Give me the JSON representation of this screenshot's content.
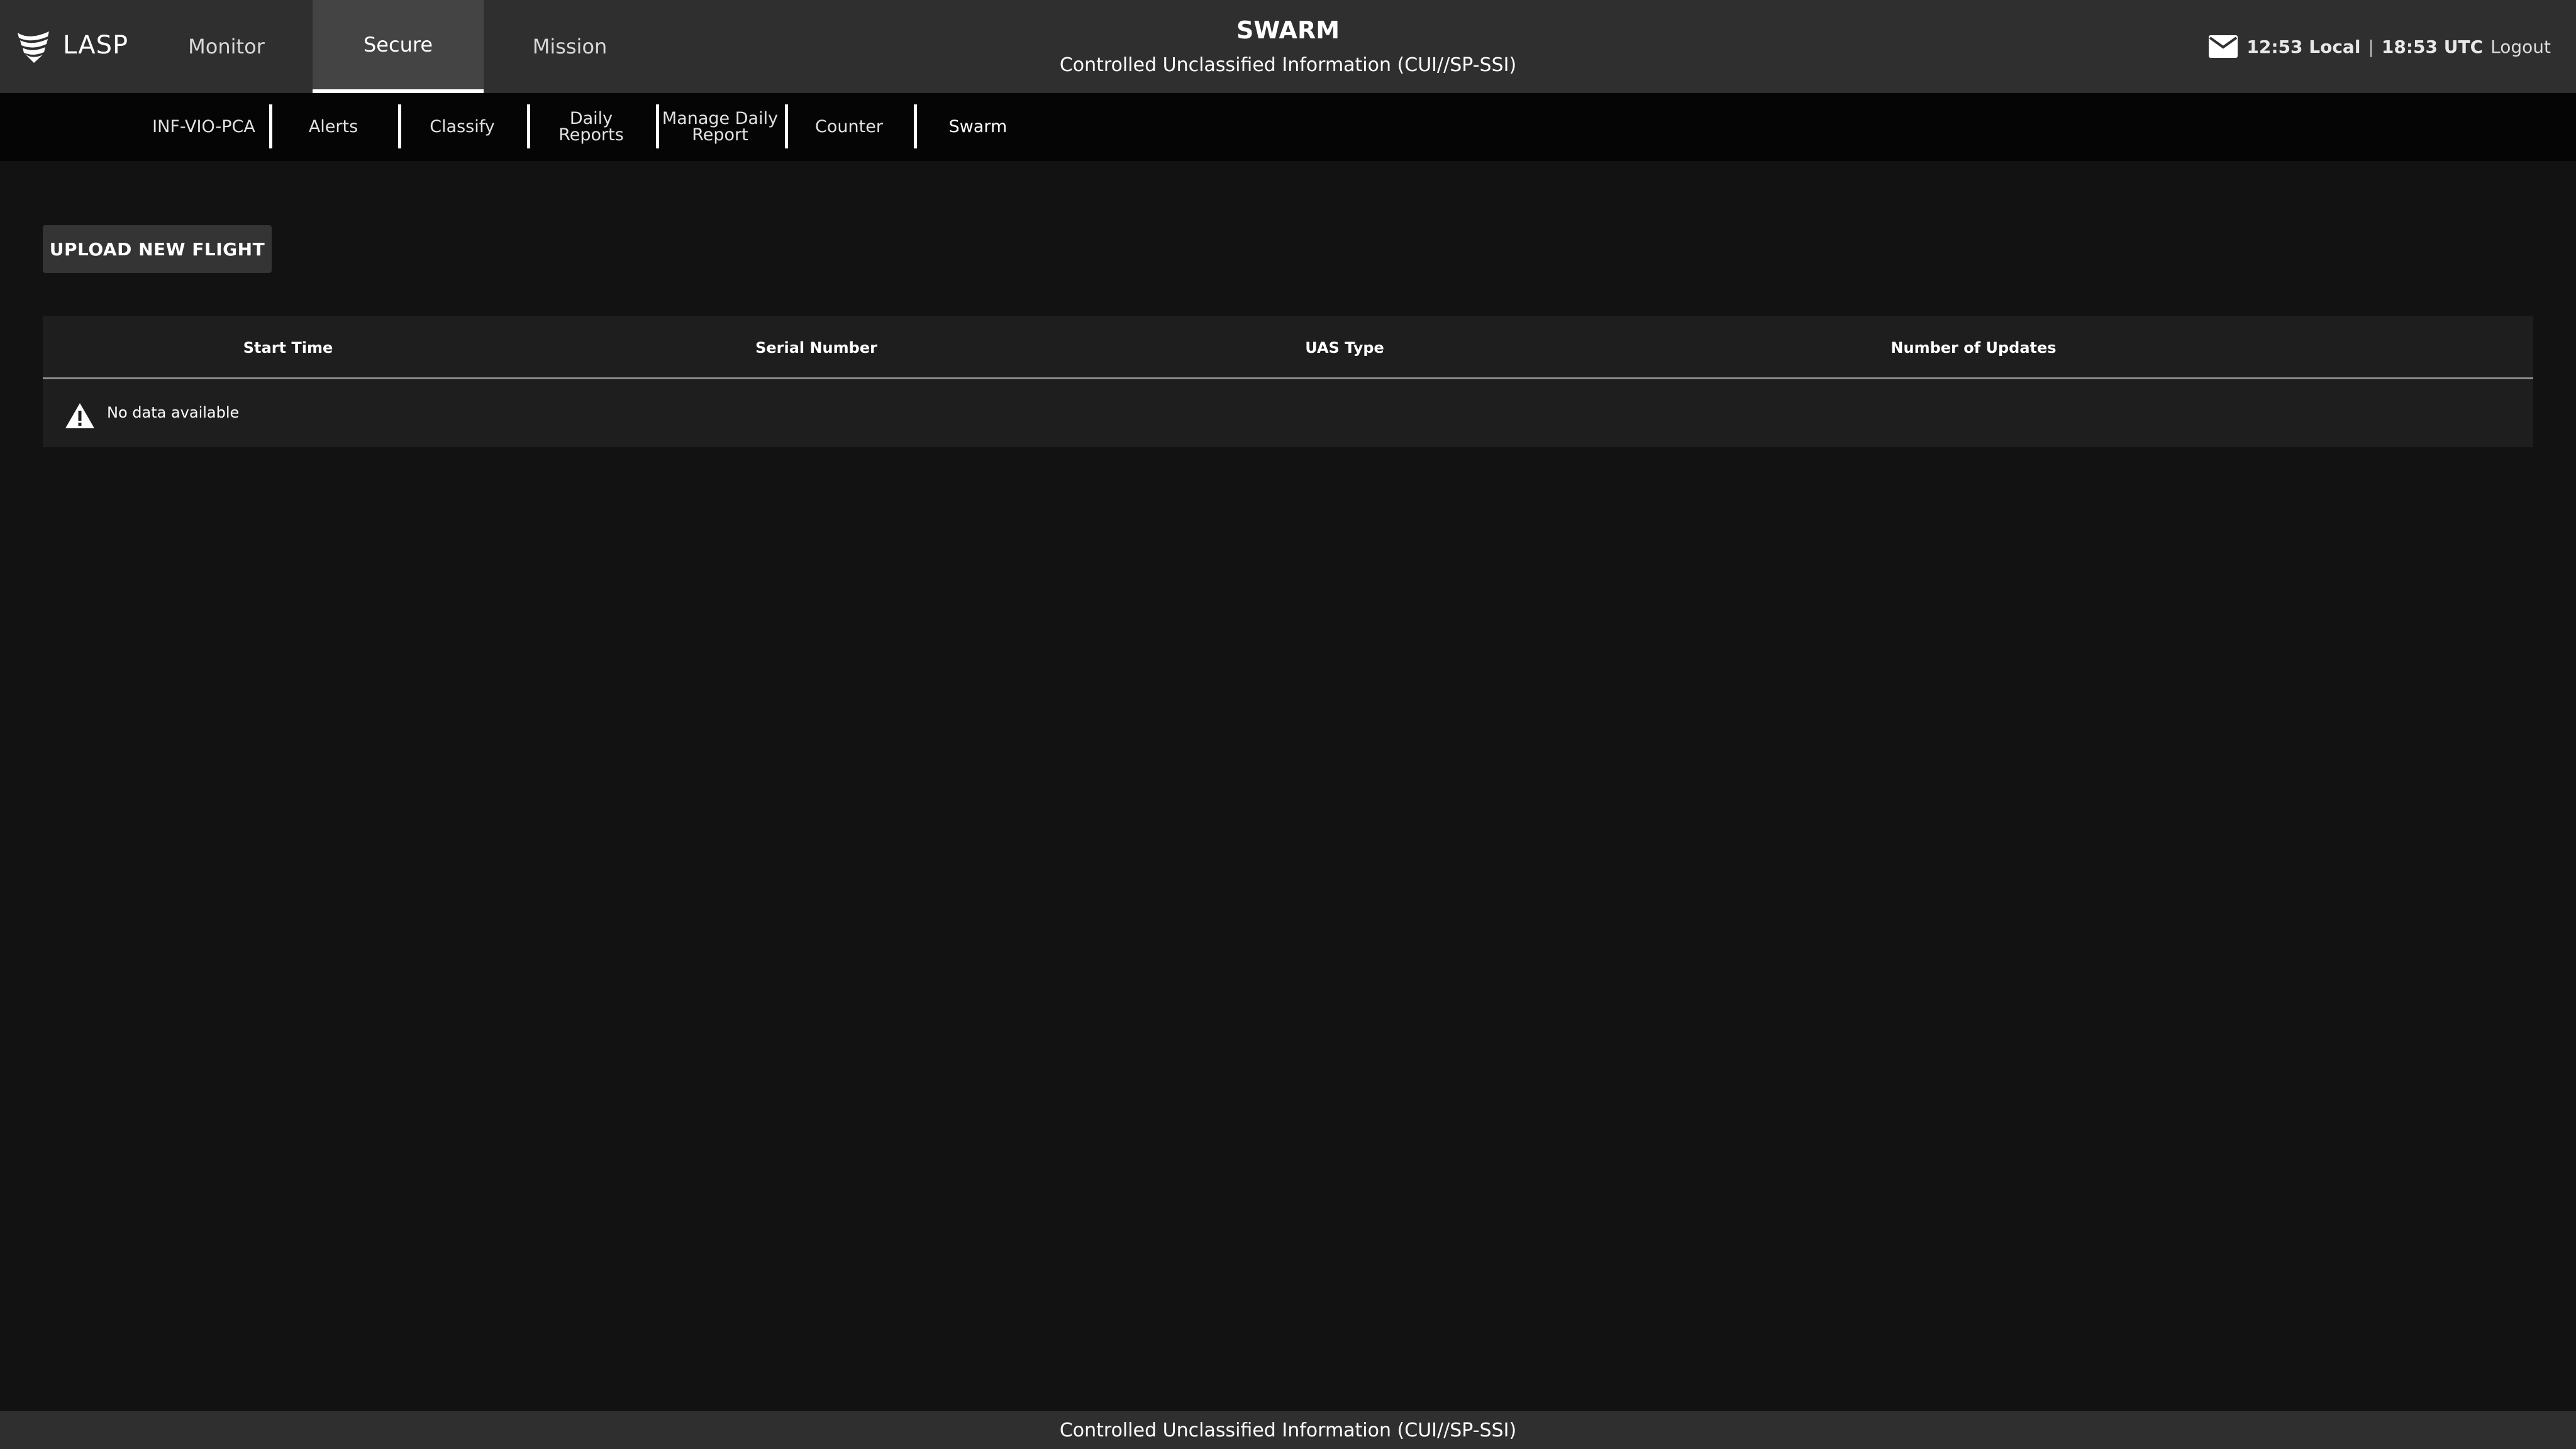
{
  "app": {
    "name": "LASP",
    "logo_icon": "shield-wings-icon"
  },
  "main_nav": {
    "tabs": [
      {
        "label": "Monitor",
        "active": false
      },
      {
        "label": "Secure",
        "active": true
      },
      {
        "label": "Mission",
        "active": false
      }
    ]
  },
  "header": {
    "title": "SWARM",
    "classification": "Controlled Unclassified Information (CUI//SP-SSI)",
    "mail_icon": "envelope-icon",
    "local_time": "12:53 Local",
    "separator": "|",
    "utc_time": "18:53 UTC",
    "logout_label": "Logout"
  },
  "sub_nav": {
    "tabs": [
      {
        "line1": "INF-VIO-PCA",
        "line2": ""
      },
      {
        "line1": "Alerts",
        "line2": ""
      },
      {
        "line1": "Classify",
        "line2": ""
      },
      {
        "line1": "Daily",
        "line2": "Reports"
      },
      {
        "line1": "Manage Daily",
        "line2": "Report"
      },
      {
        "line1": "Counter",
        "line2": ""
      },
      {
        "line1": "Swarm",
        "line2": ""
      }
    ],
    "active": "Swarm"
  },
  "content": {
    "upload_button_label": "UPLOAD NEW FLIGHT",
    "table": {
      "columns": [
        "Start Time",
        "Serial Number",
        "UAS Type",
        "Number of Updates"
      ],
      "rows": [],
      "empty_icon": "warning-triangle-icon",
      "empty_message": "No data available"
    }
  },
  "footer": {
    "classification": "Controlled Unclassified Information (CUI//SP-SSI)"
  },
  "colors": {
    "header_bg": "#2f2f2f",
    "subnav_bg": "#050505",
    "page_bg": "#121212",
    "table_bg": "#1e1e1e",
    "active_tab_bg": "#444444"
  }
}
